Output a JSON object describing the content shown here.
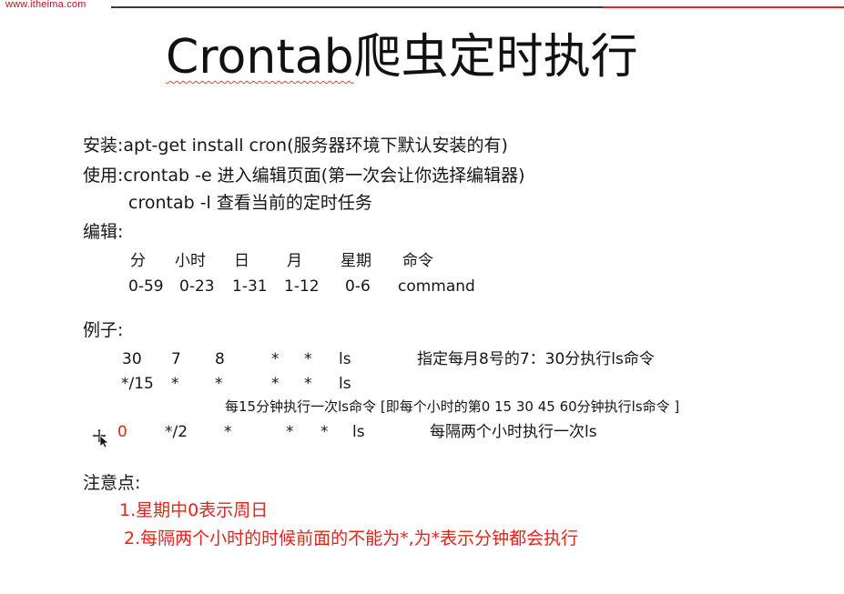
{
  "header": {
    "brand": "www.itheima.com"
  },
  "slide": {
    "title_en": "Crontab",
    "title_cn": "爬虫定时执行",
    "install": "安装:apt-get install cron(服务器环境下默认安装的有)",
    "usage_edit": "使用:crontab -e 进入编辑页面(第一次会让你选择编辑器)",
    "usage_list": "crontab -l 查看当前的定时任务",
    "edit_label": "编辑:",
    "table": {
      "headers": [
        "分",
        "小时",
        "日",
        "月",
        "星期",
        "命令"
      ],
      "ranges": [
        "0-59",
        "0-23",
        "1-31",
        "1-12",
        "0-6",
        "command"
      ]
    },
    "example_label": "例子:",
    "example1": {
      "fields": [
        "30",
        "7",
        "8",
        "*",
        "*",
        "ls"
      ],
      "desc": "指定每月8号的7：30分执行ls命令"
    },
    "example2": {
      "fields": [
        "*/15",
        "*",
        "*",
        "*",
        "*",
        "ls"
      ],
      "desc": "每15分钟执行一次ls命令 [即每个小时的第0 15 30 45 60分钟执行ls命令 ]"
    },
    "example3": {
      "fields": [
        "0",
        "*/2",
        "*",
        "*",
        "*",
        "ls"
      ],
      "desc": "每隔两个小时执行一次ls"
    },
    "notes_label": "注意点:",
    "note1": "1.星期中0表示周日",
    "note2": "2.每隔两个小时的时候前面的不能为*,为*表示分钟都会执行"
  },
  "colors": {
    "accent_red": "#e0251b",
    "brand_red": "#c0121b",
    "text": "#161616"
  },
  "icons": {
    "cursor": "move-cursor-icon"
  }
}
